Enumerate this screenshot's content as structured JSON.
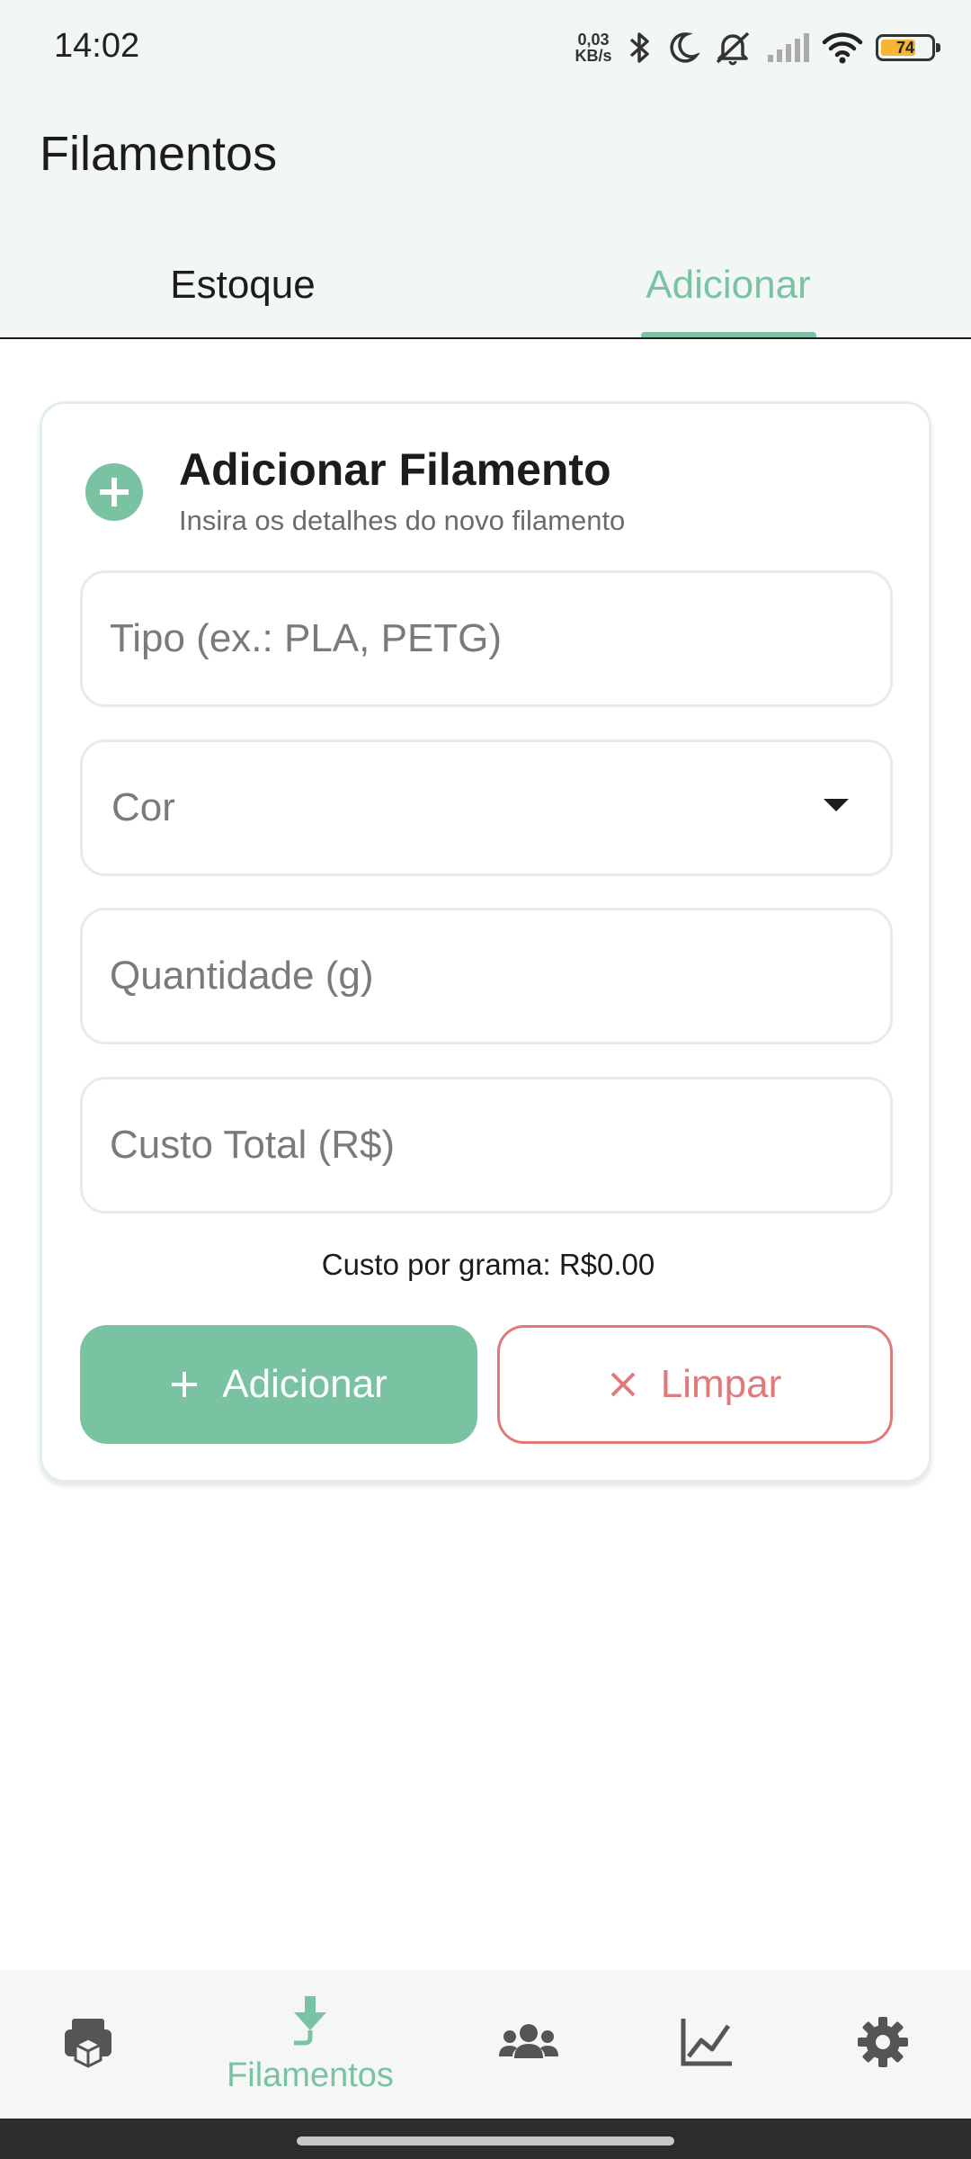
{
  "status_bar": {
    "time": "14:02",
    "net_speed_value": "0,03",
    "net_speed_unit": "KB/s",
    "battery_level": "74",
    "icons": [
      "bluetooth-icon",
      "moon-icon",
      "bell-off-icon",
      "cell-signal-icon",
      "wifi-icon",
      "battery-icon"
    ]
  },
  "app_bar": {
    "title": "Filamentos"
  },
  "tabs": [
    {
      "label": "Estoque",
      "selected": false
    },
    {
      "label": "Adicionar",
      "selected": true
    }
  ],
  "card": {
    "title": "Adicionar Filamento",
    "subtitle": "Insira os detalhes do novo filamento",
    "fields": {
      "tipo": {
        "value": "",
        "placeholder": "Tipo (ex.: PLA, PETG)"
      },
      "cor": {
        "value": "",
        "placeholder": "Cor"
      },
      "quantidade": {
        "value": "",
        "placeholder": "Quantidade (g)"
      },
      "custo": {
        "value": "",
        "placeholder": "Custo Total (R$)"
      }
    },
    "cost_per_gram": "Custo por grama: R$0.00",
    "add_button": {
      "label": "Adicionar",
      "icon": "plus-icon"
    },
    "clear_button": {
      "label": "Limpar",
      "icon": "close-icon"
    }
  },
  "bottom_nav": {
    "items": [
      {
        "icon": "printer-icon",
        "label": "",
        "selected": false
      },
      {
        "icon": "filament-download-icon",
        "label": "Filamentos",
        "selected": true
      },
      {
        "icon": "users-icon",
        "label": "",
        "selected": false
      },
      {
        "icon": "chart-line-icon",
        "label": "",
        "selected": false
      },
      {
        "icon": "gear-icon",
        "label": "",
        "selected": false
      }
    ]
  },
  "colors": {
    "accent": "#79c3a3",
    "danger": "#e07a7a",
    "header_bg": "#f2f7f5",
    "battery_fill": "#f5b731"
  }
}
